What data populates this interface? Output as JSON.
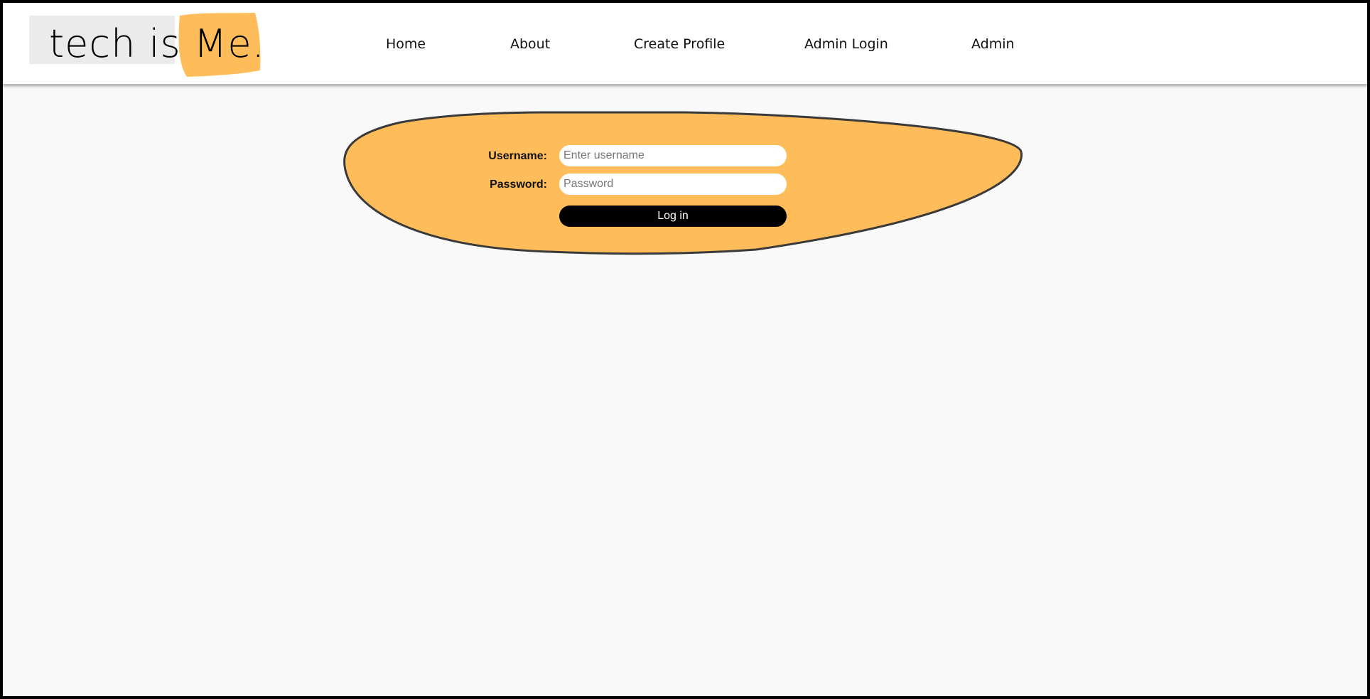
{
  "brand": {
    "text_plain": "tech is ",
    "text_highlight": "Me.",
    "highlight_color": "#febc5a",
    "grey_color": "#ebebeb"
  },
  "nav": {
    "items": [
      {
        "label": "Home"
      },
      {
        "label": "About"
      },
      {
        "label": "Create Profile"
      },
      {
        "label": "Admin Login"
      },
      {
        "label": "Admin"
      }
    ]
  },
  "login": {
    "username_label": "Username:",
    "username_placeholder": "Enter username",
    "password_label": "Password:",
    "password_placeholder": "Password",
    "submit_label": "Log in"
  },
  "colors": {
    "accent": "#febc5a",
    "button": "#000000",
    "page_bg": "#f9f9f9",
    "header_bg": "#ffffff"
  }
}
